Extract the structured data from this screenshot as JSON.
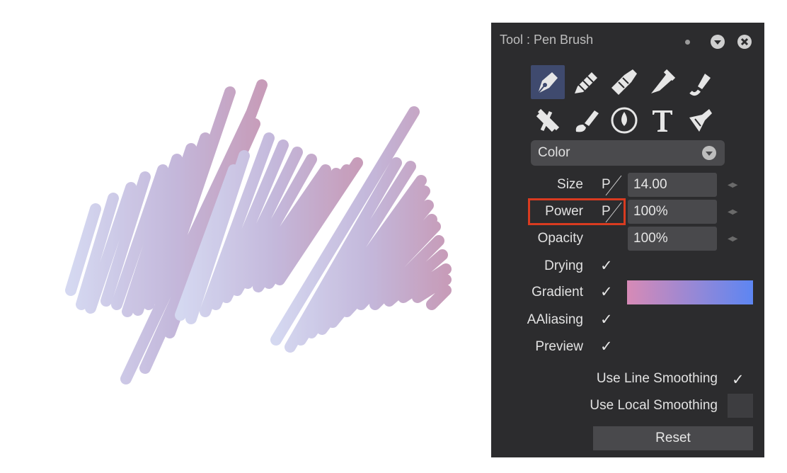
{
  "panel": {
    "title": "Tool : Pen Brush",
    "tools_row1": [
      "pen-nib-icon",
      "pencil-icon",
      "marker-icon",
      "felt-pen-icon",
      "brush-stroke-icon"
    ],
    "tools_row2": [
      "eraser-icon",
      "paint-brush-icon",
      "water-drop-icon",
      "text-icon",
      "smudge-icon"
    ],
    "selected_tool": "pen-nib-icon",
    "mode_dropdown": "Color",
    "params": [
      {
        "label": "Size",
        "pressure": "P",
        "value": "14.00"
      },
      {
        "label": "Power",
        "pressure": "P",
        "value": "100%"
      },
      {
        "label": "Opacity",
        "value": "100%"
      }
    ],
    "toggles": [
      {
        "label": "Drying",
        "checked": true
      },
      {
        "label": "Gradient",
        "checked": true
      },
      {
        "label": "AAliasing",
        "checked": true
      },
      {
        "label": "Preview",
        "checked": true
      }
    ],
    "check_glyph": "✓",
    "gradient_colors": {
      "start": "#d78ab6",
      "end": "#5d86f2"
    },
    "options": [
      {
        "label": "Use Line Smoothing",
        "checked": true
      },
      {
        "label": "Use Local Smoothing",
        "checked": false
      }
    ],
    "reset_label": "Reset",
    "highlight_color": "#d93b20"
  },
  "canvas": {
    "stroke_colors": {
      "start": "#c9cdeb",
      "end": "#c693b5"
    }
  }
}
